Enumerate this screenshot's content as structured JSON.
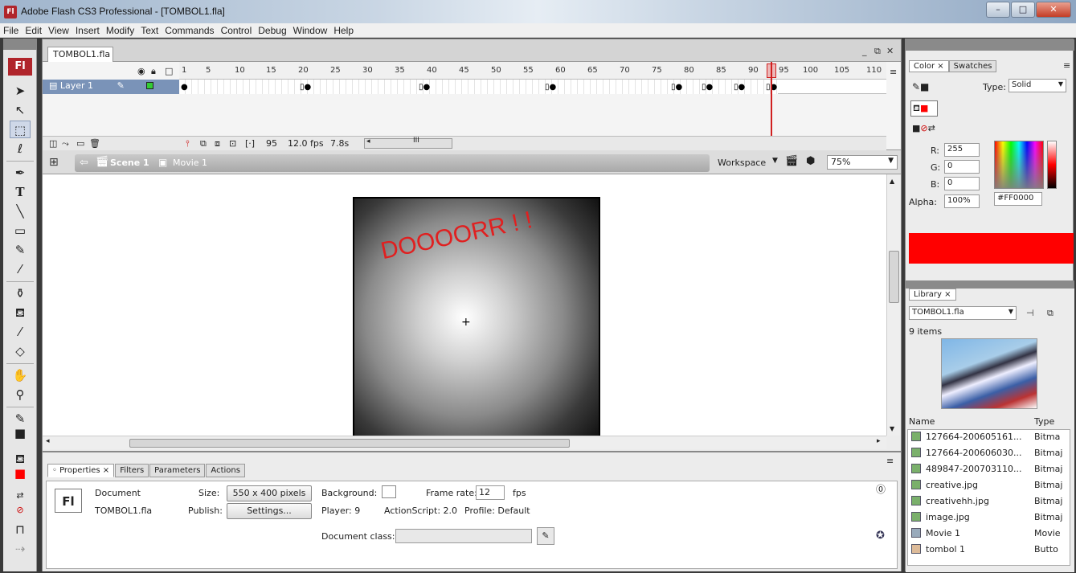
{
  "window": {
    "title": "Adobe Flash CS3 Professional - [TOMBOL1.fla]",
    "app_icon": "Fl"
  },
  "menu": [
    "File",
    "Edit",
    "View",
    "Insert",
    "Modify",
    "Text",
    "Commands",
    "Control",
    "Debug",
    "Window",
    "Help"
  ],
  "document": {
    "tab": "TOMBOL1.fla",
    "timeline": {
      "frame_numbers": [
        "1",
        "5",
        "10",
        "15",
        "20",
        "25",
        "30",
        "35",
        "40",
        "45",
        "50",
        "55",
        "60",
        "65",
        "70",
        "75",
        "80",
        "85",
        "90",
        "95",
        "100",
        "105",
        "110"
      ],
      "layer_name": "Layer 1",
      "current_frame": "95",
      "fps": "12.0 fps",
      "time": "7.8s"
    },
    "scene": {
      "scene_label": "Scene 1",
      "symbol_label": "Movie 1",
      "workspace_label": "Workspace",
      "zoom": "75%"
    },
    "stage_text": "DOOOORR ! !"
  },
  "properties": {
    "tabs": [
      "Properties",
      "Filters",
      "Parameters",
      "Actions"
    ],
    "doc_label": "Document",
    "doc_file": "TOMBOL1.fla",
    "size_label": "Size:",
    "size_value": "550 x 400 pixels",
    "publish_label": "Publish:",
    "settings_button": "Settings...",
    "background_label": "Background:",
    "frame_rate_label": "Frame rate:",
    "frame_rate_value": "12",
    "fps_label": "fps",
    "player_label": "Player: 9",
    "actionscript_label": "ActionScript: 2.0",
    "profile_label": "Profile: Default",
    "doc_class_label": "Document class:",
    "fl_logo": "Fl"
  },
  "color_panel": {
    "tabs": [
      "Color",
      "Swatches"
    ],
    "type_label": "Type:",
    "type_value": "Solid",
    "r_label": "R:",
    "r_value": "255",
    "g_label": "G:",
    "g_value": "0",
    "b_label": "B:",
    "b_value": "0",
    "alpha_label": "Alpha:",
    "alpha_value": "100%",
    "hex_value": "#FF0000",
    "color": "#ff0000"
  },
  "library": {
    "tab": "Library",
    "file": "TOMBOL1.fla",
    "count": "9 items",
    "col_name": "Name",
    "col_type": "Type",
    "items": [
      {
        "name": "127664-200605161...",
        "type": "Bitma"
      },
      {
        "name": "127664-200606030...",
        "type": "Bitmaj"
      },
      {
        "name": "489847-200703110...",
        "type": "Bitmaj"
      },
      {
        "name": "creative.jpg",
        "type": "Bitmaj"
      },
      {
        "name": "creativehh.jpg",
        "type": "Bitmaj"
      },
      {
        "name": "image.jpg",
        "type": "Bitmaj"
      },
      {
        "name": "Movie 1",
        "type": "Movie"
      },
      {
        "name": "tombol 1",
        "type": "Butto"
      }
    ]
  }
}
